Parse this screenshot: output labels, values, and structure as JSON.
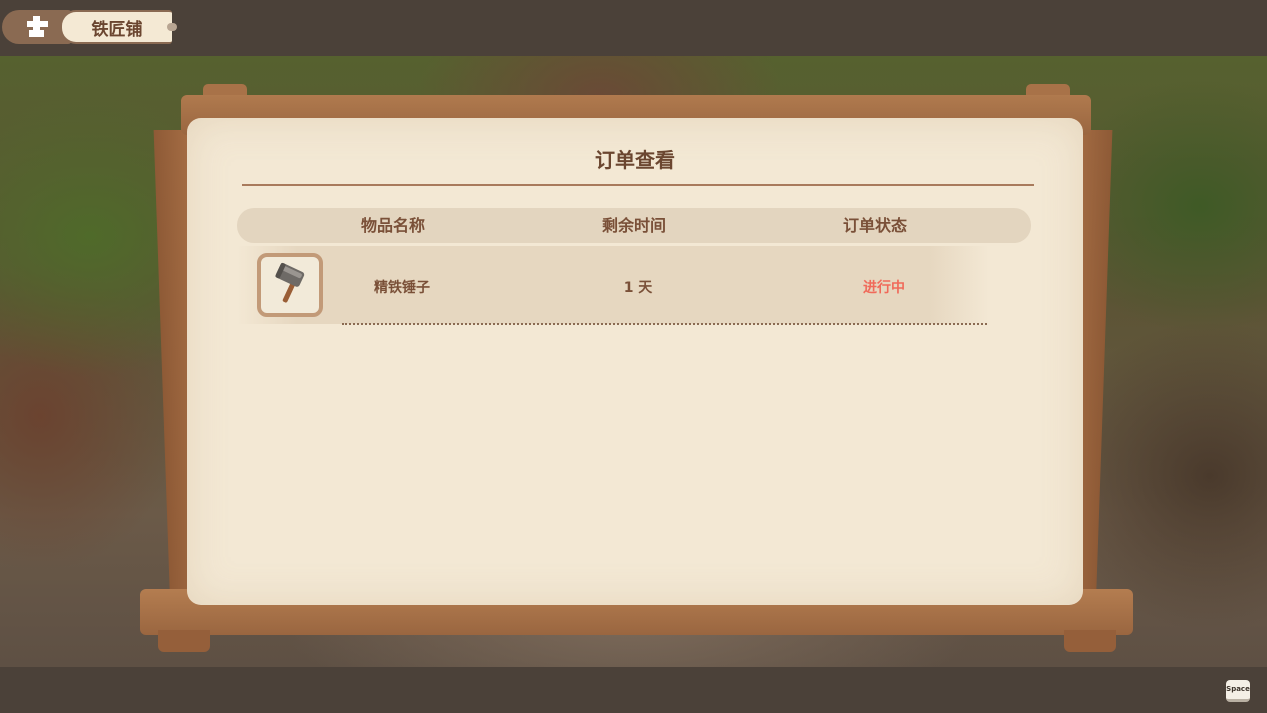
{
  "location": {
    "icon": "anvil-icon",
    "name": "铁匠铺"
  },
  "panel": {
    "title": "订单查看",
    "columns": [
      "物品名称",
      "剩余时间",
      "订单状态"
    ],
    "orders": [
      {
        "icon": "hammer-icon",
        "item_name": "精铁锤子",
        "time_left": "1 天",
        "status": "进行中",
        "status_color": "#f06a5a"
      }
    ]
  },
  "hint": {
    "key_label": "Space"
  }
}
